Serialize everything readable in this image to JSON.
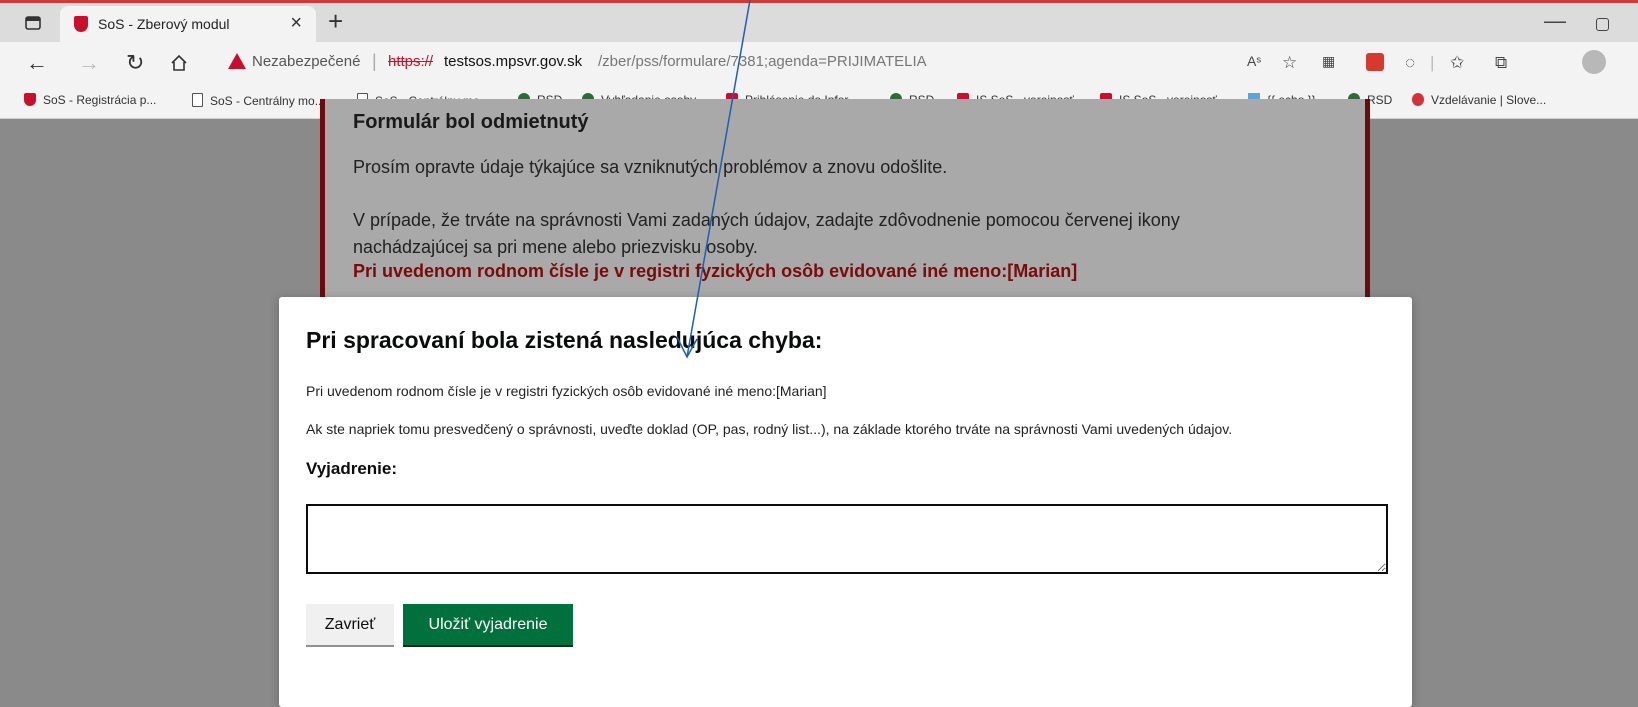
{
  "browser": {
    "tab_title": "SoS - Zberový modul",
    "tab_close": "×",
    "new_tab": "+",
    "minimize": "—",
    "security_label": "Nezabezpečené",
    "url_scheme": "https://",
    "url_host": "testsos.mpsvr.gov.sk",
    "url_path": "/zber/pss/formulare/7381;agenda=PRIJIMATELIA",
    "read_aloud": "Aˢ"
  },
  "bookmarks": [
    {
      "label": "SoS - Registrácia p...",
      "icon": "shield-icon"
    },
    {
      "label": "SoS - Centrálny mo...",
      "icon": "page-icon"
    },
    {
      "label": "SoS - Centrálny mo...",
      "icon": "page-icon"
    },
    {
      "label": "RSD",
      "icon": "people-icon"
    },
    {
      "label": "Vyhľadanie osoby",
      "icon": "people-icon"
    },
    {
      "label": "Prihlásenie do Infor...",
      "icon": "shield-icon"
    },
    {
      "label": "RSD",
      "icon": "people-icon"
    },
    {
      "label": "IS SoS - verejnosť",
      "icon": "shield-icon"
    },
    {
      "label": "IS SoS - verejnosť",
      "icon": "shield-icon"
    },
    {
      "label": "{{ echo }}",
      "icon": "image-icon"
    },
    {
      "label": "RSD",
      "icon": "people-icon"
    },
    {
      "label": "Vzdelávanie | Slove...",
      "icon": "circle-icon"
    }
  ],
  "background_alert": {
    "heading": "Formulár bol odmietnutý",
    "para1": "Prosím opravte údaje týkajúce sa vzniknutých problémov a znovu odošlite.",
    "para2": "V prípade, že trváte na správnosti Vami zadaných údajov, zadajte zdôvodnenie pomocou červenej ikony nachádzajúcej sa pri mene alebo priezvisku osoby.",
    "para3": "Pri uvedenom rodnom čísle je v registri fyzických osôb evidované iné meno:[Marian]"
  },
  "modal": {
    "heading": "Pri spracovaní bola zistená nasledujúca chyba:",
    "message1": "Pri uvedenom rodnom čísle je v registri fyzických osôb evidované iné meno:[Marian]",
    "message2": "Ak ste napriek tomu presvedčený o správnosti, uveďte doklad (OP, pas, rodný list...), na základe ktorého trváte na správnosti Vami uvedených údajov.",
    "field_label": "Vyjadrenie:",
    "field_value": "",
    "close_label": "Zavrieť",
    "save_label": "Uložiť vyjadrenie"
  },
  "colors": {
    "brand_red": "#c8102e",
    "save_green": "#00703c",
    "annotation_arrow": "#1f5fae"
  }
}
